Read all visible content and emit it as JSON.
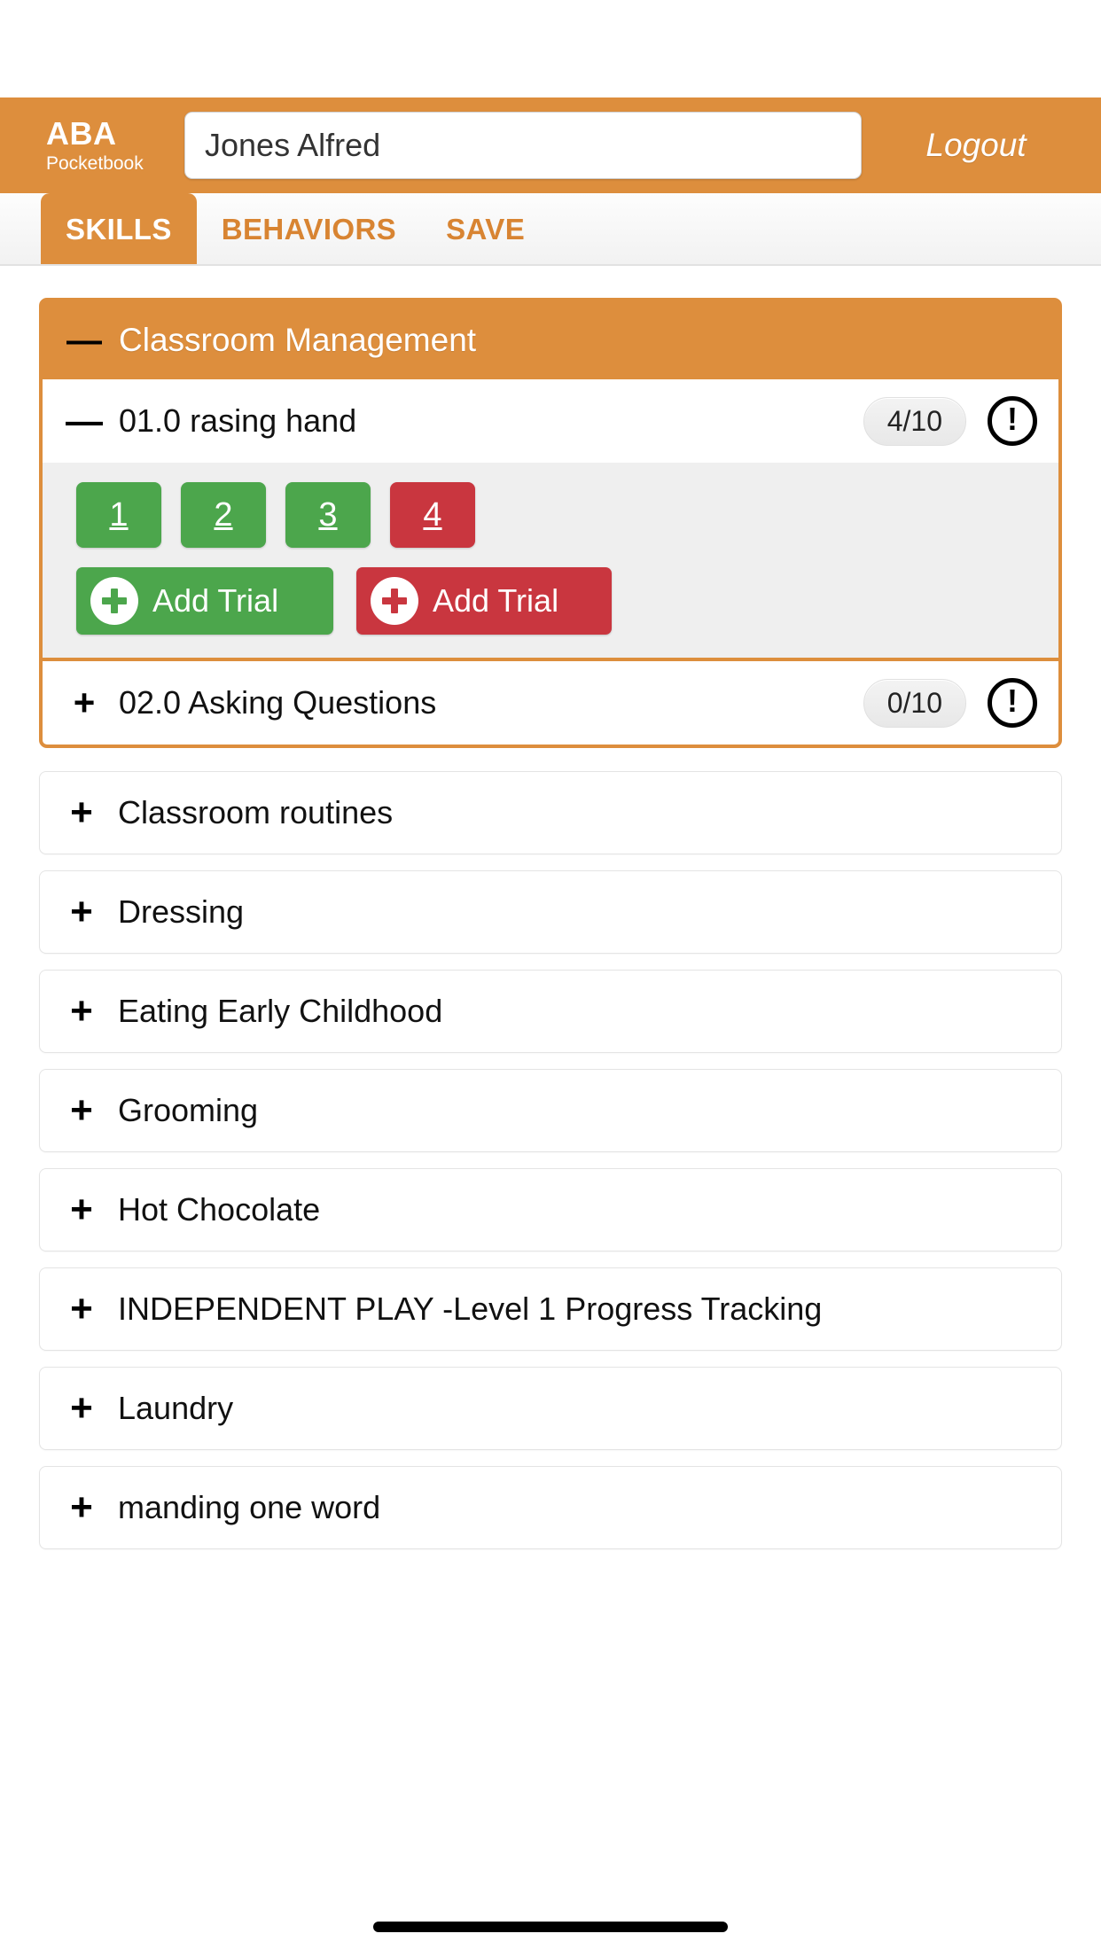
{
  "header": {
    "brand_title": "ABA",
    "brand_subtitle": "Pocketbook",
    "client_value": "Jones Alfred",
    "client_placeholder": "Client name",
    "logout_label": "Logout",
    "accent_color": "#dd8e3d"
  },
  "tabs": [
    {
      "label": "SKILLS",
      "active": true
    },
    {
      "label": "BEHAVIORS",
      "active": false
    },
    {
      "label": "SAVE",
      "active": false
    }
  ],
  "open_group": {
    "sign": "—",
    "title": "Classroom Management",
    "skills": [
      {
        "sign": "—",
        "label": "01.0 rasing hand",
        "score": "4/10",
        "alert": "!",
        "expanded": true,
        "trials": [
          {
            "number": "1",
            "result": "correct"
          },
          {
            "number": "2",
            "result": "correct"
          },
          {
            "number": "3",
            "result": "correct"
          },
          {
            "number": "4",
            "result": "incorrect"
          }
        ],
        "add_correct_label": "Add Trial",
        "add_incorrect_label": "Add Trial"
      },
      {
        "sign": "+",
        "label": "02.0 Asking Questions",
        "score": "0/10",
        "alert": "!",
        "expanded": false
      }
    ]
  },
  "collapsed_groups": [
    {
      "sign": "+",
      "label": "Classroom routines"
    },
    {
      "sign": "+",
      "label": "Dressing"
    },
    {
      "sign": "+",
      "label": "Eating Early Childhood"
    },
    {
      "sign": "+",
      "label": "Grooming"
    },
    {
      "sign": "+",
      "label": "Hot Chocolate"
    },
    {
      "sign": "+",
      "label": "INDEPENDENT PLAY -Level 1 Progress Tracking"
    },
    {
      "sign": "+",
      "label": "Laundry"
    },
    {
      "sign": "+",
      "label": "manding one word"
    }
  ],
  "colors": {
    "accent": "#dd8e3d",
    "correct": "#4CA64C",
    "incorrect": "#C9363F"
  }
}
